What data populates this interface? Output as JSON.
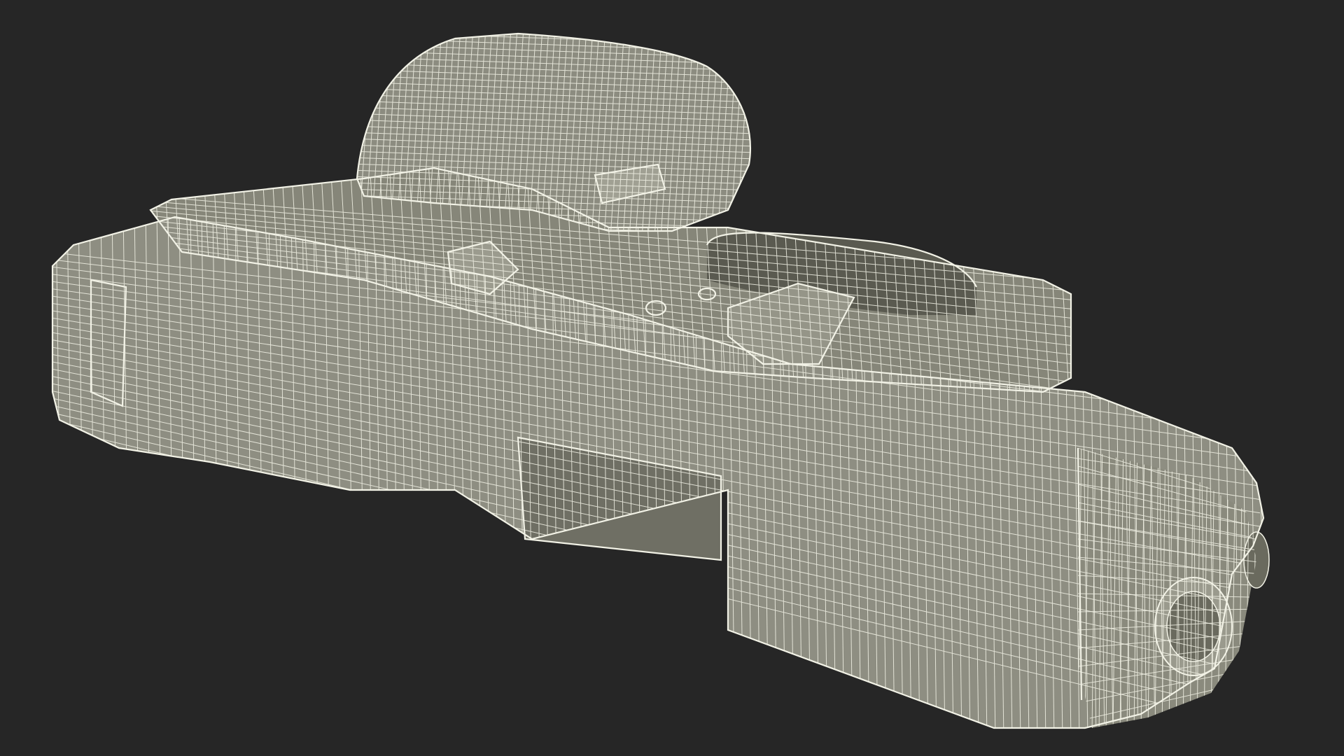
{
  "scene": {
    "subject": "pistol-wireframe-model",
    "colors": {
      "background": "#262626",
      "surface": "#8e8e82",
      "surface_light": "#a3a396",
      "surface_dark": "#5e5e55",
      "wire": "#f2f2e6",
      "wire_faint": "#d8d8ca"
    }
  }
}
